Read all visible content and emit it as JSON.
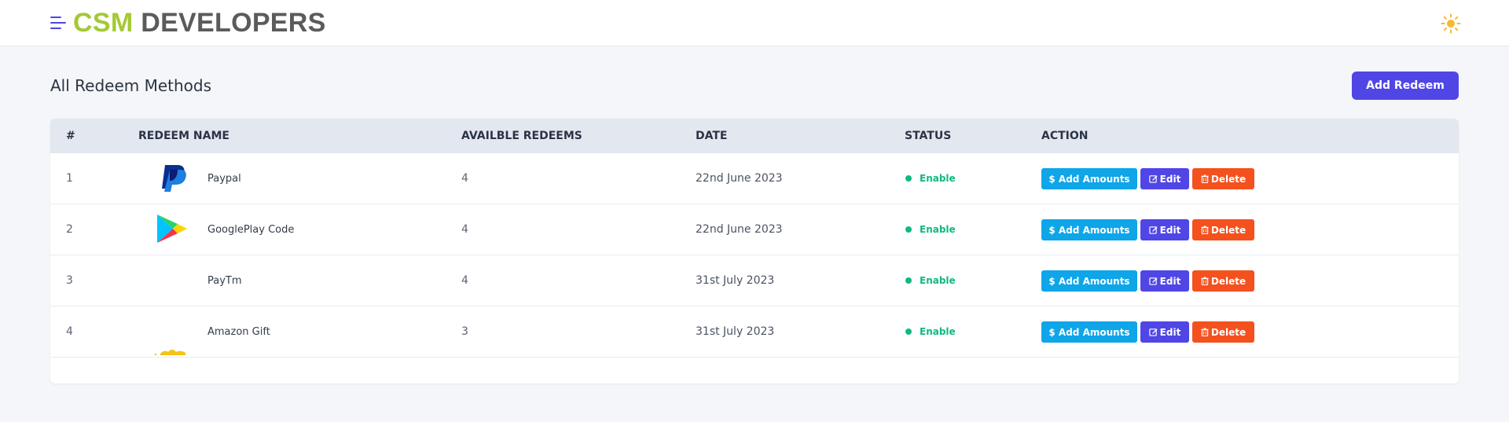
{
  "header": {
    "brand_part1": "CSM",
    "brand_part2": "DEVELOPERS",
    "menu_icon": "hamburger-menu-icon",
    "theme_icon": "sun-icon"
  },
  "page": {
    "title": "All Redeem Methods",
    "add_button_label": "Add Redeem"
  },
  "table": {
    "columns": [
      "#",
      "REDEEM NAME",
      "AVAILBLE REDEEMS",
      "DATE",
      "STATUS",
      "ACTION"
    ],
    "rows": [
      {
        "index": "1",
        "name": "Paypal",
        "available": "4",
        "date": "22nd June 2023",
        "status": "Enable",
        "logo": "paypal-logo"
      },
      {
        "index": "2",
        "name": "GooglePlay Code",
        "available": "4",
        "date": "22nd June 2023",
        "status": "Enable",
        "logo": "google-play-logo"
      },
      {
        "index": "3",
        "name": "PayTm",
        "available": "4",
        "date": "31st July 2023",
        "status": "Enable",
        "logo": ""
      },
      {
        "index": "4",
        "name": "Amazon Gift",
        "available": "3",
        "date": "31st July 2023",
        "status": "Enable",
        "logo": "amazon-gift-logo"
      }
    ],
    "actions": {
      "add_amounts": "$ Add Amounts",
      "edit": "Edit",
      "delete": "Delete"
    }
  },
  "colors": {
    "brand_green": "#a4c935",
    "brand_gray": "#5b5b5b",
    "primary": "#4f46e5",
    "info": "#0ea5e9",
    "danger": "#f4511e",
    "success": "#10b981"
  }
}
